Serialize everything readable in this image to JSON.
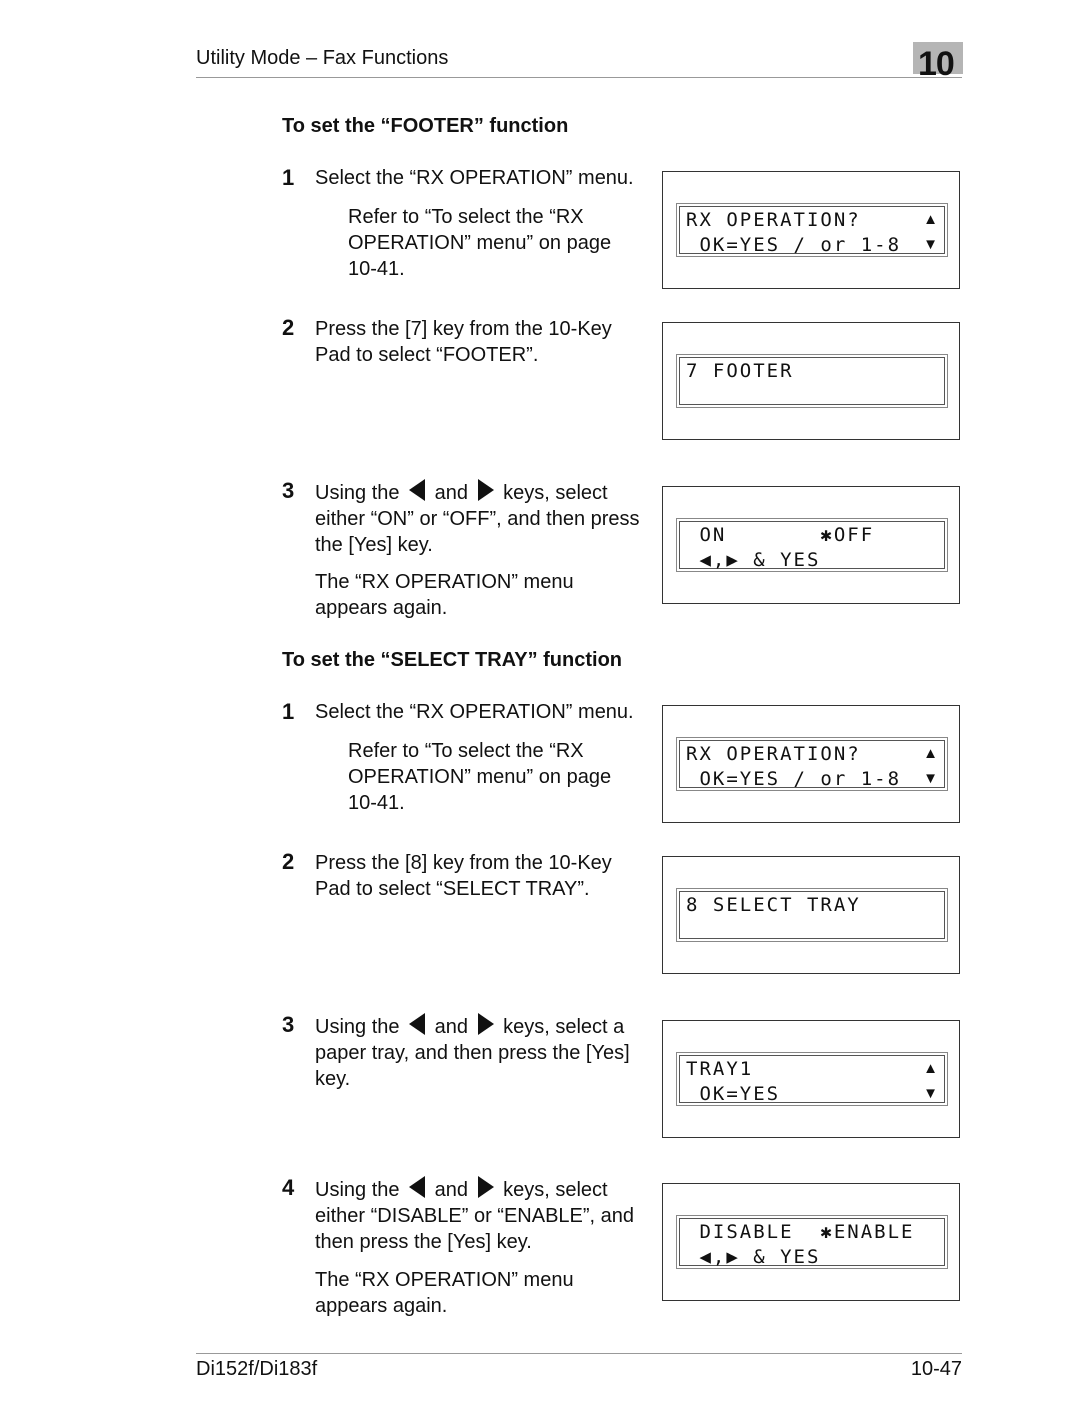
{
  "header": {
    "title": "Utility Mode – Fax Functions",
    "chapter": "10"
  },
  "footer": {
    "model": "Di152f/Di183f",
    "page": "10-47"
  },
  "sections": [
    {
      "title": "To set the “FOOTER” function",
      "steps": [
        {
          "num": "1",
          "text": "Select the “RX OPERATION” menu.",
          "note": "Refer to “To select the “RX OPERATION” menu” on page 10-41.",
          "lcd": {
            "line1": "RX OPERATION?",
            "line2": " OK=YES / or 1-8",
            "up_icon": "▲",
            "down_icon": "▼"
          }
        },
        {
          "num": "2",
          "text": "Press the [7] key from the 10-Key Pad to select “FOOTER”.",
          "lcd": {
            "line1": "7 FOOTER",
            "line2": ""
          }
        },
        {
          "num": "3",
          "text_pre": "Using the",
          "text_mid": "and",
          "text_post": "keys, select either “ON” or “OFF”, and then press the [Yes] key.",
          "sub": "The “RX OPERATION” menu appears again.",
          "lcd": {
            "line1": " ON       ✱OFF",
            "line2": " ◀,▶ & YES"
          }
        }
      ]
    },
    {
      "title": "To set the “SELECT TRAY” function",
      "steps": [
        {
          "num": "1",
          "text": "Select the “RX OPERATION” menu.",
          "note": "Refer to “To select the “RX OPERATION” menu” on page 10-41.",
          "lcd": {
            "line1": "RX OPERATION?",
            "line2": " OK=YES / or 1-8",
            "up_icon": "▲",
            "down_icon": "▼"
          }
        },
        {
          "num": "2",
          "text": "Press the [8] key from the 10-Key Pad to select “SELECT TRAY”.",
          "lcd": {
            "line1": "8 SELECT TRAY",
            "line2": ""
          }
        },
        {
          "num": "3",
          "text_pre": "Using the",
          "text_mid": "and",
          "text_post": "keys, select a paper tray, and then press the [Yes] key.",
          "lcd": {
            "line1": "TRAY1",
            "line2": " OK=YES",
            "up_icon": "▲",
            "down_icon": "▼"
          }
        },
        {
          "num": "4",
          "text_pre": "Using the",
          "text_mid": "and",
          "text_post": "keys, select either “DISABLE” or “ENABLE”, and then press the [Yes] key.",
          "sub": "The “RX OPERATION” menu appears again.",
          "lcd": {
            "line1": " DISABLE  ✱ENABLE",
            "line2": " ◀,▶ & YES"
          }
        }
      ]
    }
  ]
}
